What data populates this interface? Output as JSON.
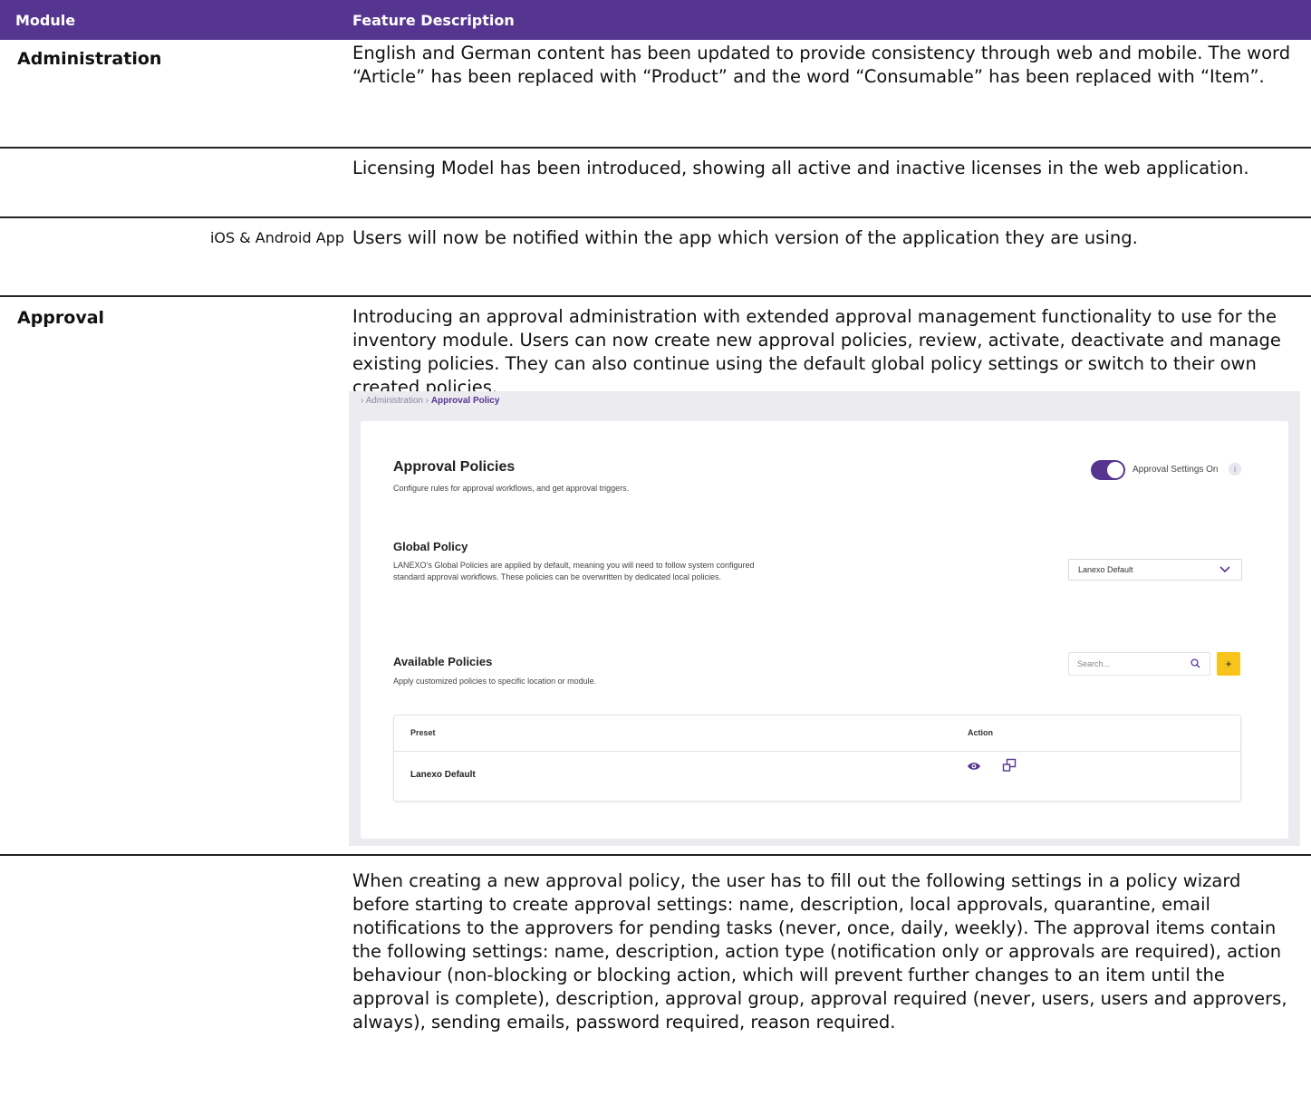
{
  "header": {
    "module": "Module",
    "feature": "Feature Description"
  },
  "rows": [
    {
      "module": "Administration",
      "description": "English and German content has been updated to provide consistency through web and mobile. The word “Article” has been replaced with “Product” and the word “Consumable” has been replaced with “Item”."
    },
    {
      "module": "",
      "description": "Licensing Model has been introduced, showing all active and inactive licenses in the web application."
    },
    {
      "module": "",
      "sublabel": "iOS & Android App",
      "description": "Users will now be notified within the app which version of the application they are using."
    },
    {
      "module": "Approval",
      "description": "Introducing an approval administration with extended approval management functionality to use for the inventory module. Users can now create new approval policies, review, activate, deactivate and manage existing policies. They can also continue using the default global policy settings or switch to their own created policies."
    },
    {
      "module": "",
      "description": "When creating a new approval policy, the user has to fill out the following settings in a policy wizard before starting to create approval settings: name, description, local approvals, quarantine, email notifications to the approvers for pending tasks (never, once, daily, weekly). The approval items contain the following settings: name, description, action type (notification only or approvals are required), action behaviour (non-blocking or blocking action, which will prevent further changes to an item until the approval is complete), description, approval group, approval required (never, users, users and approvers, always), sending emails, password required, reason required."
    }
  ],
  "screenshot": {
    "breadcrumb": {
      "parent": "Administration",
      "current": "Approval Policy"
    },
    "title": "Approval Policies",
    "subtitle": "Configure rules for approval workflows, and get approval triggers.",
    "toggle_label": "Approval Settings On",
    "toggle_on": true,
    "info_glyph": "i",
    "global": {
      "title": "Global Policy",
      "line1": "LANEXO’s Global Policies are applied by default, meaning you will need to follow system configured",
      "line2": "standard approval workflows. These policies can be overwritten by dedicated local policies.",
      "select_value": "Lanexo Default"
    },
    "available": {
      "title": "Available Policies",
      "subtitle": "Apply customized policies to specific location or module.",
      "search_placeholder": "Search...",
      "add_label": "+",
      "columns": [
        "Preset",
        "Action"
      ],
      "rows": [
        {
          "preset": "Lanexo Default"
        }
      ]
    },
    "colors": {
      "accent": "#55358f",
      "add": "#f8c41c"
    },
    "icons": [
      "chevron-right-icon",
      "info-icon",
      "chevron-down-icon",
      "search-icon",
      "plus-icon",
      "eye-icon",
      "copy-icon"
    ]
  }
}
